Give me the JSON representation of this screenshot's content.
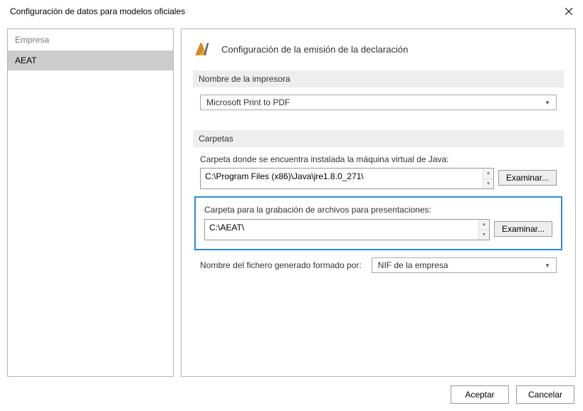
{
  "titlebar": {
    "title": "Configuración de datos para modelos oficiales"
  },
  "sidebar": {
    "header": "Empresa",
    "items": [
      {
        "label": "AEAT"
      }
    ]
  },
  "panel": {
    "title": "Configuración de la emisión de la declaración"
  },
  "printer": {
    "section_label": "Nombre de la impresora",
    "selected": "Microsoft Print to PDF"
  },
  "folders": {
    "section_label": "Carpetas",
    "java": {
      "label": "Carpeta donde se encuentra instalada la máquina virtual de Java:",
      "path": "C:\\Program Files (x86)\\Java\\jre1.8.0_271\\",
      "browse": "Examinar..."
    },
    "recording": {
      "label": "Carpeta para la grabación de archivos para presentaciones:",
      "path": "C:\\AEAT\\",
      "browse": "Examinar..."
    },
    "filename": {
      "label": "Nombre del fichero generado formado por:",
      "selected": "NIF de la empresa"
    }
  },
  "buttons": {
    "accept": "Aceptar",
    "cancel": "Cancelar"
  }
}
